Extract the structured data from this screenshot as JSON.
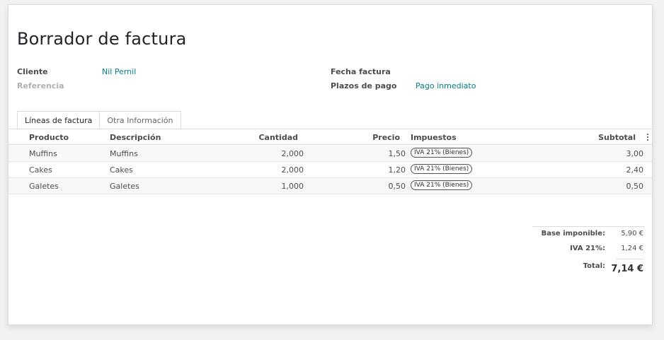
{
  "title": "Borrador de factura",
  "fields": {
    "cliente_label": "Cliente",
    "cliente_value": "Nil Pernil",
    "referencia_label": "Referencia",
    "fecha_label": "Fecha factura",
    "plazos_label": "Plazos de pago",
    "plazos_value": "Pago inmediato"
  },
  "tabs": [
    {
      "label": "Líneas de factura",
      "active": true
    },
    {
      "label": "Otra Información",
      "active": false
    }
  ],
  "table": {
    "headers": {
      "producto": "Producto",
      "descripcion": "Descripción",
      "cantidad": "Cantidad",
      "precio": "Precio",
      "impuestos": "Impuestos",
      "subtotal": "Subtotal"
    },
    "rows": [
      {
        "producto": "Muffins",
        "descripcion": "Muffins",
        "cantidad": "2,000",
        "precio": "1,50",
        "impuesto": "IVA 21% (Bienes)",
        "subtotal": "3,00"
      },
      {
        "producto": "Cakes",
        "descripcion": "Cakes",
        "cantidad": "2,000",
        "precio": "1,20",
        "impuesto": "IVA 21% (Bienes)",
        "subtotal": "2,40"
      },
      {
        "producto": "Galetes",
        "descripcion": "Galetes",
        "cantidad": "1,000",
        "precio": "0,50",
        "impuesto": "IVA 21% (Bienes)",
        "subtotal": "0,50"
      }
    ]
  },
  "totals": {
    "base_label": "Base imponible:",
    "base_value": "5,90 €",
    "iva_label": "IVA 21%:",
    "iva_value": "1,24 €",
    "total_label": "Total:",
    "total_value": "7,14 €"
  },
  "colors": {
    "link": "#017e84",
    "border": "#dcdcdc",
    "background": "#f2f2f2"
  },
  "icons": {
    "column_options": "kebab-icon"
  }
}
